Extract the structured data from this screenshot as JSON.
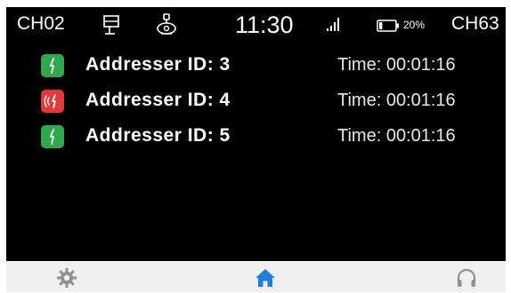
{
  "status": {
    "left_channel": "CH02",
    "time": "11:30",
    "battery_percent": "20%",
    "battery_level": 0.2,
    "right_channel": "CH63",
    "icons": [
      "network-icon",
      "wireless-mic-icon",
      "signal-bars-icon",
      "battery-icon"
    ]
  },
  "addressers": [
    {
      "label": "Addresser ID: 3",
      "time": "Time: 00:01:16",
      "state": "connected",
      "color": "#2fa84f"
    },
    {
      "label": "Addresser ID: 4",
      "time": "Time: 00:01:16",
      "state": "calling",
      "color": "#e23a3a"
    },
    {
      "label": "Addresser ID: 5",
      "time": "Time: 00:01:16",
      "state": "connected",
      "color": "#2fa84f"
    }
  ],
  "nav": {
    "items": [
      {
        "name": "settings",
        "icon": "gear-icon"
      },
      {
        "name": "home",
        "icon": "home-icon",
        "active": true,
        "color": "#1f7fe0"
      },
      {
        "name": "audio",
        "icon": "headphones-icon"
      }
    ]
  }
}
